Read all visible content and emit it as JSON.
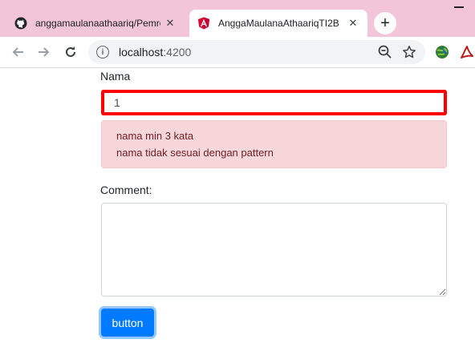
{
  "browser": {
    "tabs": [
      {
        "title": "anggamaulanaathaariq/Pemrograman",
        "favicon": "github-icon",
        "active": false
      },
      {
        "title": "AnggaMaulanaAthaariqTI2B",
        "favicon": "angular-icon",
        "active": true
      }
    ],
    "close_glyph": "✕",
    "newtab_glyph": "+",
    "address": {
      "host": "localhost",
      "port": ":4200"
    }
  },
  "form": {
    "nama_label": "Nama",
    "nama_value": "1",
    "errors": [
      "nama min 3 kata",
      "nama tidak sesuai dengan pattern"
    ],
    "comment_label": "Comment:",
    "comment_value": "",
    "button_label": "button"
  },
  "colors": {
    "tabstrip": "#f3c5d8",
    "error_border": "#ff0000",
    "alert_bg": "#f8d7da",
    "alert_text": "#721c24",
    "button": "#007bff"
  }
}
